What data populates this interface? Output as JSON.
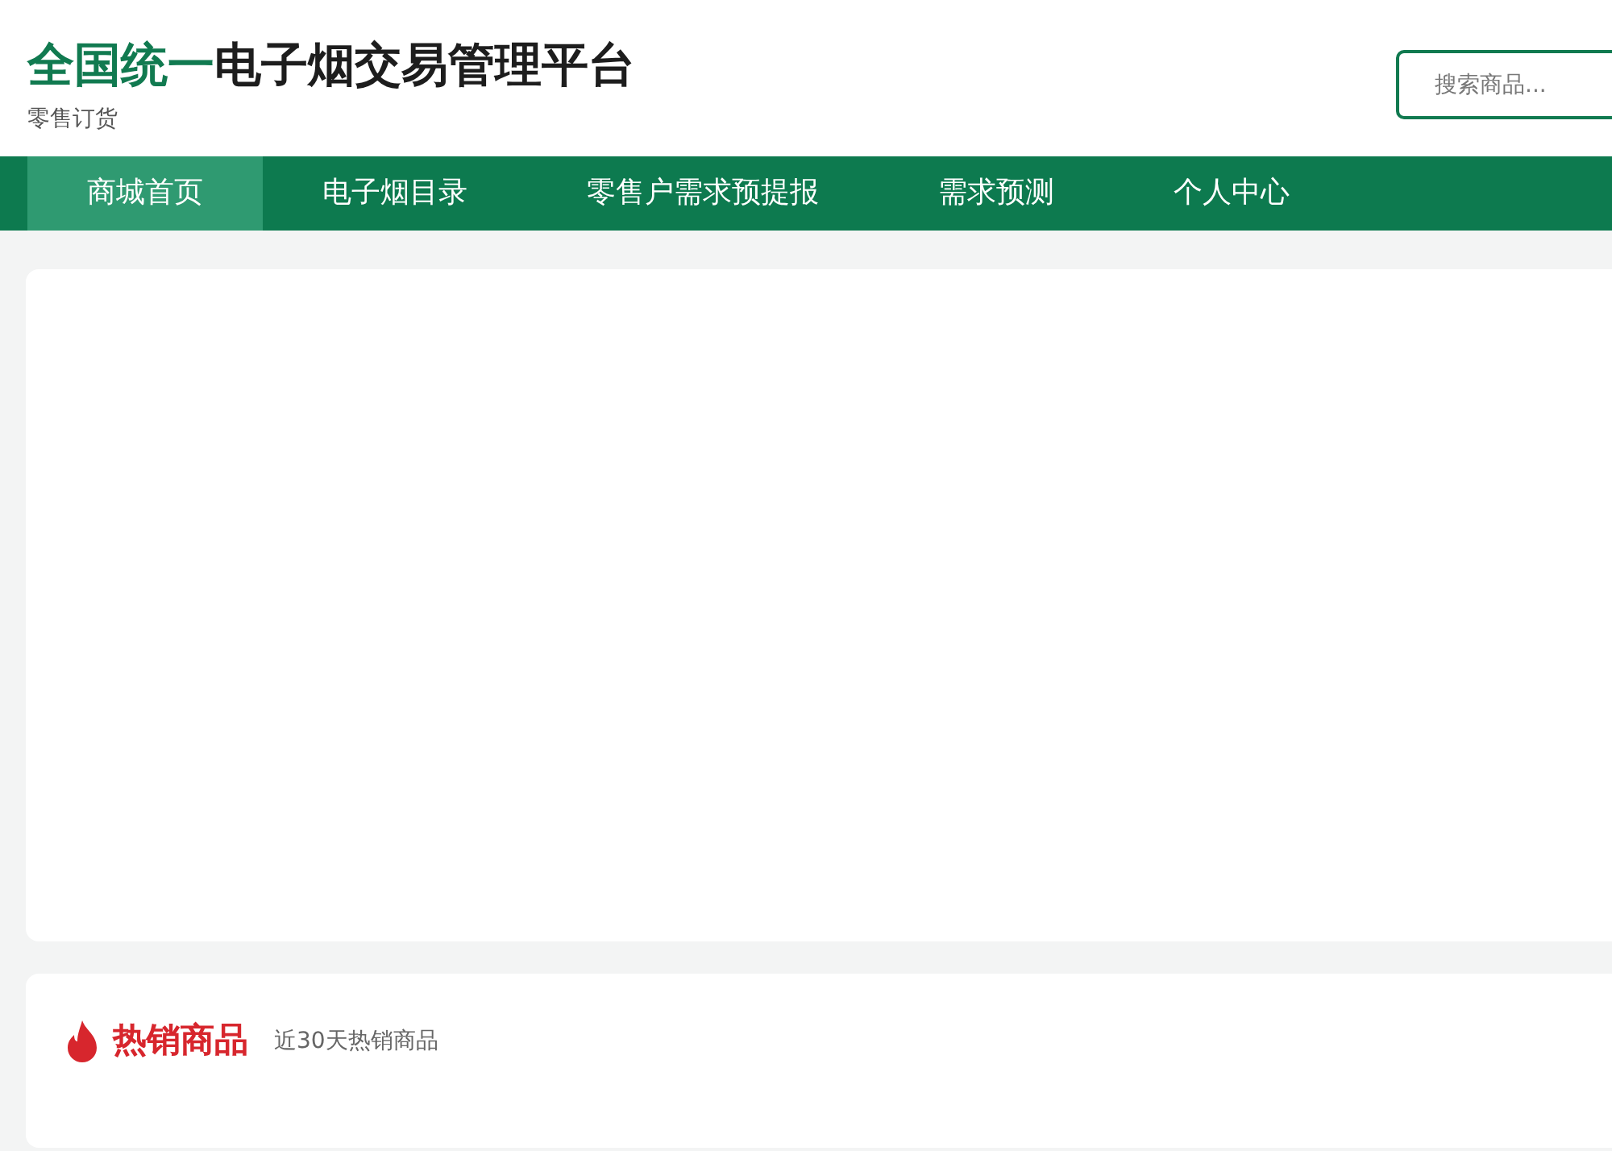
{
  "header": {
    "title_highlight": "全国统一",
    "title_rest": "电子烟交易管理平台",
    "subtitle": "零售订货"
  },
  "search": {
    "placeholder": "搜索商品..."
  },
  "nav": [
    {
      "label": "商城首页",
      "selected": true
    },
    {
      "label": "电子烟目录",
      "selected": false
    },
    {
      "label": "零售户需求预提报",
      "selected": false
    },
    {
      "label": "需求预测",
      "selected": false
    },
    {
      "label": "个人中心",
      "selected": false
    }
  ],
  "hot_section": {
    "title": "热销商品",
    "subtitle": "近30天热销商品"
  }
}
